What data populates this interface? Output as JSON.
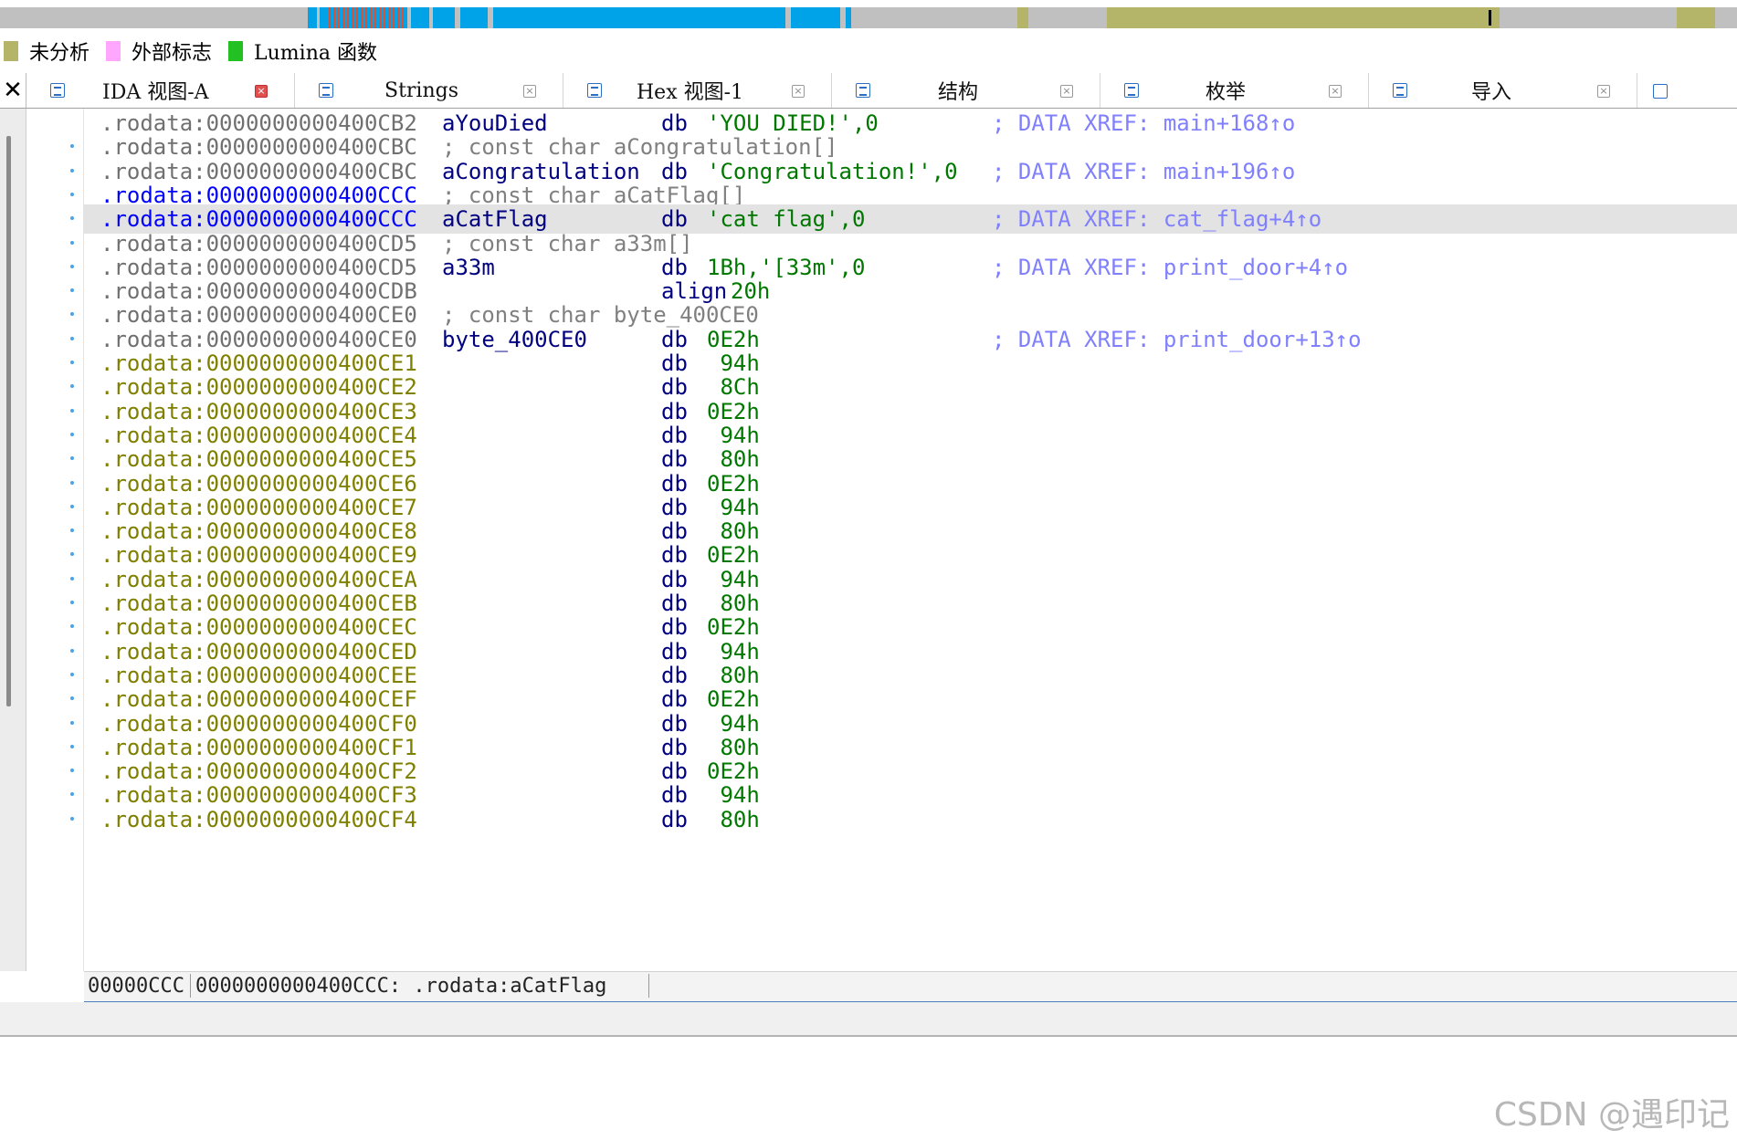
{
  "legend": [
    {
      "label": "未分析",
      "color": "#b5b56a"
    },
    {
      "label": "外部标志",
      "color": "#ffa6ff"
    },
    {
      "label": "Lumina 函数",
      "color": "#22c022"
    }
  ],
  "tabs": [
    {
      "label": "IDA 视图-A",
      "active": true
    },
    {
      "label": "Strings",
      "active": false
    },
    {
      "label": "Hex 视图-1",
      "active": false
    },
    {
      "label": "结构",
      "active": false
    },
    {
      "label": "枚举",
      "active": false
    },
    {
      "label": "导入",
      "active": false
    }
  ],
  "listing": [
    {
      "addr": ".rodata:0000000000400CB2",
      "name": "aYouDied",
      "mnemonic": "db",
      "operand": "'YOU DIED!',0",
      "xref": "; DATA XREF: main+168↑o",
      "addr_color": "grey"
    },
    {
      "addr": ".rodata:0000000000400CBC",
      "comment": "; const char aCongratulation[]",
      "addr_color": "grey"
    },
    {
      "addr": ".rodata:0000000000400CBC",
      "name": "aCongratulation",
      "mnemonic": "db",
      "operand": "'Congratulation!',0",
      "xref": "; DATA XREF: main+196↑o",
      "addr_color": "grey"
    },
    {
      "addr": ".rodata:0000000000400CCC",
      "comment": "; const char aCatFlag[]",
      "addr_color": "blue"
    },
    {
      "addr": ".rodata:0000000000400CCC",
      "name": "aCatFlag",
      "mnemonic": "db",
      "operand": "'cat flag',0",
      "xref": "; DATA XREF: cat_flag+4↑o",
      "addr_color": "blue",
      "selected": true
    },
    {
      "addr": ".rodata:0000000000400CD5",
      "comment": "; const char a33m[]",
      "addr_color": "grey"
    },
    {
      "addr": ".rodata:0000000000400CD5",
      "name": "a33m",
      "mnemonic": "db",
      "operand": "1Bh,'[33m',0",
      "xref": "; DATA XREF: print_door+4↑o",
      "addr_color": "grey"
    },
    {
      "addr": ".rodata:0000000000400CDB",
      "mnemonic": "align",
      "operand": "20h",
      "addr_color": "grey"
    },
    {
      "addr": ".rodata:0000000000400CE0",
      "comment": "; const char byte_400CE0",
      "addr_color": "grey"
    },
    {
      "addr": ".rodata:0000000000400CE0",
      "name": "byte_400CE0",
      "mnemonic": "db",
      "operand": "0E2h",
      "xref": "; DATA XREF: print_door+13↑o",
      "addr_color": "grey"
    },
    {
      "addr": ".rodata:0000000000400CE1",
      "mnemonic": "db",
      "operand": " 94h",
      "addr_color": "olive"
    },
    {
      "addr": ".rodata:0000000000400CE2",
      "mnemonic": "db",
      "operand": " 8Ch",
      "addr_color": "olive"
    },
    {
      "addr": ".rodata:0000000000400CE3",
      "mnemonic": "db",
      "operand": "0E2h",
      "addr_color": "olive"
    },
    {
      "addr": ".rodata:0000000000400CE4",
      "mnemonic": "db",
      "operand": " 94h",
      "addr_color": "olive"
    },
    {
      "addr": ".rodata:0000000000400CE5",
      "mnemonic": "db",
      "operand": " 80h",
      "addr_color": "olive"
    },
    {
      "addr": ".rodata:0000000000400CE6",
      "mnemonic": "db",
      "operand": "0E2h",
      "addr_color": "olive"
    },
    {
      "addr": ".rodata:0000000000400CE7",
      "mnemonic": "db",
      "operand": " 94h",
      "addr_color": "olive"
    },
    {
      "addr": ".rodata:0000000000400CE8",
      "mnemonic": "db",
      "operand": " 80h",
      "addr_color": "olive"
    },
    {
      "addr": ".rodata:0000000000400CE9",
      "mnemonic": "db",
      "operand": "0E2h",
      "addr_color": "olive"
    },
    {
      "addr": ".rodata:0000000000400CEA",
      "mnemonic": "db",
      "operand": " 94h",
      "addr_color": "olive"
    },
    {
      "addr": ".rodata:0000000000400CEB",
      "mnemonic": "db",
      "operand": " 80h",
      "addr_color": "olive"
    },
    {
      "addr": ".rodata:0000000000400CEC",
      "mnemonic": "db",
      "operand": "0E2h",
      "addr_color": "olive"
    },
    {
      "addr": ".rodata:0000000000400CED",
      "mnemonic": "db",
      "operand": " 94h",
      "addr_color": "olive"
    },
    {
      "addr": ".rodata:0000000000400CEE",
      "mnemonic": "db",
      "operand": " 80h",
      "addr_color": "olive"
    },
    {
      "addr": ".rodata:0000000000400CEF",
      "mnemonic": "db",
      "operand": "0E2h",
      "addr_color": "olive"
    },
    {
      "addr": ".rodata:0000000000400CF0",
      "mnemonic": "db",
      "operand": " 94h",
      "addr_color": "olive"
    },
    {
      "addr": ".rodata:0000000000400CF1",
      "mnemonic": "db",
      "operand": " 80h",
      "addr_color": "olive"
    },
    {
      "addr": ".rodata:0000000000400CF2",
      "mnemonic": "db",
      "operand": "0E2h",
      "addr_color": "olive"
    },
    {
      "addr": ".rodata:0000000000400CF3",
      "mnemonic": "db",
      "operand": " 94h",
      "addr_color": "olive"
    },
    {
      "addr": ".rodata:0000000000400CF4",
      "mnemonic": "db",
      "operand": " 80h",
      "addr_color": "olive"
    }
  ],
  "status": {
    "offset": "00000CCC",
    "location": "0000000000400CCC: .rodata:aCatFlag"
  },
  "watermark": "CSDN @遇印记",
  "colors": {
    "nav_code": "#00a2e8",
    "nav_unexplored": "#b5b56a",
    "nav_grey": "#c0c0c0",
    "selected_row": "#e3e3e3",
    "xref": "#8080ff",
    "data_operand": "#007800",
    "name": "#000080"
  },
  "icons": {
    "tab_close": "close-icon",
    "tab_view": "view-icon"
  }
}
